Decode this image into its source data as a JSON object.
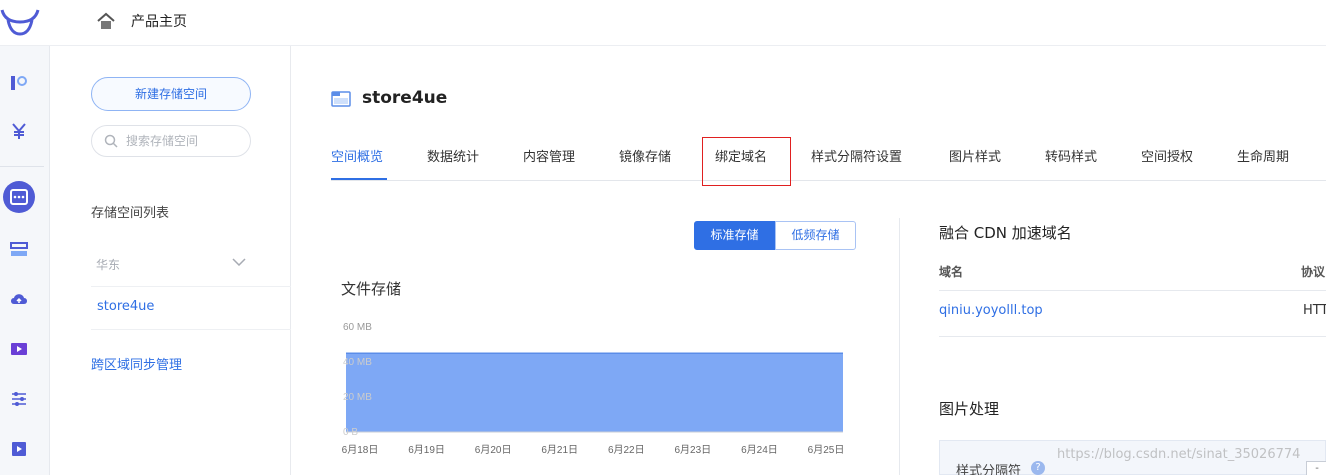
{
  "topbar": {
    "title": "产品主页"
  },
  "sidebar": {
    "new_bucket_label": "新建存储空间",
    "search_placeholder": "搜索存储空间",
    "list_heading": "存储空间列表",
    "region": "华东",
    "bucket_item": "store4ue",
    "sync_link": "跨区域同步管理"
  },
  "main": {
    "bucket_title": "store4ue",
    "tabs": [
      {
        "label": "空间概览",
        "active": true
      },
      {
        "label": "数据统计"
      },
      {
        "label": "内容管理"
      },
      {
        "label": "镜像存储"
      },
      {
        "label": "绑定域名",
        "highlighted": true
      },
      {
        "label": "样式分隔符设置"
      },
      {
        "label": "图片样式"
      },
      {
        "label": "转码样式"
      },
      {
        "label": "空间授权"
      },
      {
        "label": "生命周期"
      }
    ],
    "storage_toggle": {
      "standard": "标准存储",
      "infrequent": "低频存储",
      "selected": "标准存储"
    },
    "file_storage_title": "文件存储"
  },
  "chart_data": {
    "type": "area",
    "title": "文件存储",
    "x": [
      "6月18日",
      "6月19日",
      "6月20日",
      "6月21日",
      "6月22日",
      "6月23日",
      "6月24日",
      "6月25日"
    ],
    "yticks": [
      "60 MB",
      "40 MB",
      "20 MB",
      "0 B"
    ],
    "ylim": [
      0,
      60
    ],
    "series": [
      {
        "values": [
          45,
          45,
          45,
          45,
          45,
          45,
          45,
          45
        ]
      }
    ],
    "color": "#7ea8f5",
    "grid": false
  },
  "cdn": {
    "title": "融合 CDN 加速域名",
    "col_domain": "域名",
    "col_protocol": "协议",
    "domain": "qiniu.yoyolll.top",
    "protocol": "HTT"
  },
  "image_processing": {
    "title": "图片处理",
    "separator_label": "样式分隔符",
    "help": "?",
    "button": "-"
  },
  "watermark": "https://blog.csdn.net/sinat_35026774",
  "colors": {
    "accent": "#2f6fe4",
    "highlight_box": "#e02020",
    "rail_active": "#4f5bd5"
  }
}
